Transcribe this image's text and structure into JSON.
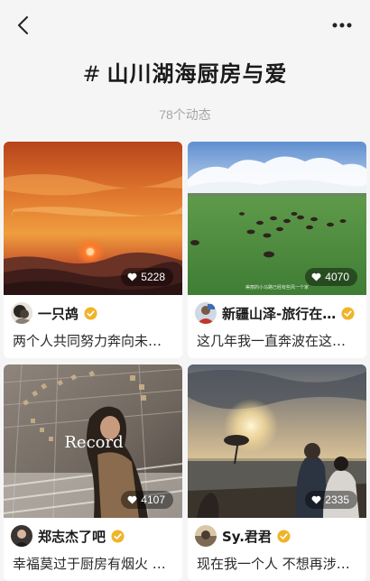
{
  "header": {
    "back_icon": "chevron-left-icon",
    "more_icon": "more-dots-icon",
    "title_hash": "#",
    "title": "山川湖海厨房与爱",
    "subtitle": "78个动态"
  },
  "posts": [
    {
      "image": "sunset-mountains",
      "likes": "5228",
      "author": "一只鸪",
      "verified": true,
      "caption": "两个人共同努力奔向未…"
    },
    {
      "image": "grassland-horses",
      "image_watermark": "美丽的小马路已经有些风一个家",
      "likes": "4070",
      "author": "新疆山泽-旅行在…",
      "verified": true,
      "caption": "这几年我一直奔波在这…"
    },
    {
      "image": "record-portrait",
      "image_text": "Record",
      "likes": "4107",
      "author": "郑志杰了吧",
      "verified": true,
      "caption": "幸福莫过于厨房有烟火 …"
    },
    {
      "image": "lakeside-sunset-couple",
      "likes": "2335",
      "author": "Sy.君君",
      "verified": true,
      "caption": "现在我一个人 不想再涉…"
    }
  ],
  "colors": {
    "background": "#f5f5f5",
    "verified_badge": "#f0b429",
    "subtitle": "#a6a6a6"
  }
}
